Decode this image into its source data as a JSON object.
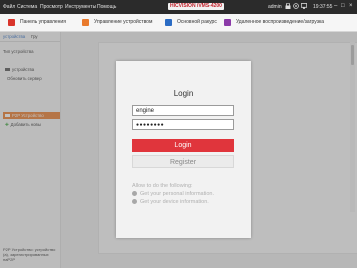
{
  "menu": [
    "Файл",
    "Система",
    "Просмотр",
    "Инструменты",
    "Помощь"
  ],
  "brand": "HICVISION iVMS-4200",
  "user": "admin",
  "time": "19:37:55",
  "window_controls": [
    "–",
    "□",
    "×"
  ],
  "tabs": [
    {
      "label": "Панель управления",
      "icon_color": "#d9342b"
    },
    {
      "label": "Управление устройством",
      "icon_color": "#e97a2c"
    },
    {
      "label": "Основной ракурс",
      "icon_color": "#2b6cc4"
    },
    {
      "label": "Удаленное воспроизведение/загрузка",
      "icon_color": "#8b3aa8"
    }
  ],
  "sidebar": {
    "tabs": [
      "устройства",
      "Гру"
    ],
    "type_label": "Тип устройства",
    "items": [
      "устройства",
      "Обновить сервер",
      "P2P Устройство",
      "Добавить новы"
    ],
    "bottom_text": "P2P Устройство: устройство (а), зарегистрированных наP2P"
  },
  "dialog": {
    "title": "Login",
    "username": "engine",
    "password_mask": "●●●●●●●●",
    "login_button": "Login",
    "register_button": "Register",
    "allow_heading": "Allow to do the following:",
    "permissions": [
      "Get your personal information.",
      "Get your device information."
    ]
  },
  "colors": {
    "accent": "#e0353c",
    "selected": "#e97a2c",
    "menubar": "#2b2b2b"
  }
}
